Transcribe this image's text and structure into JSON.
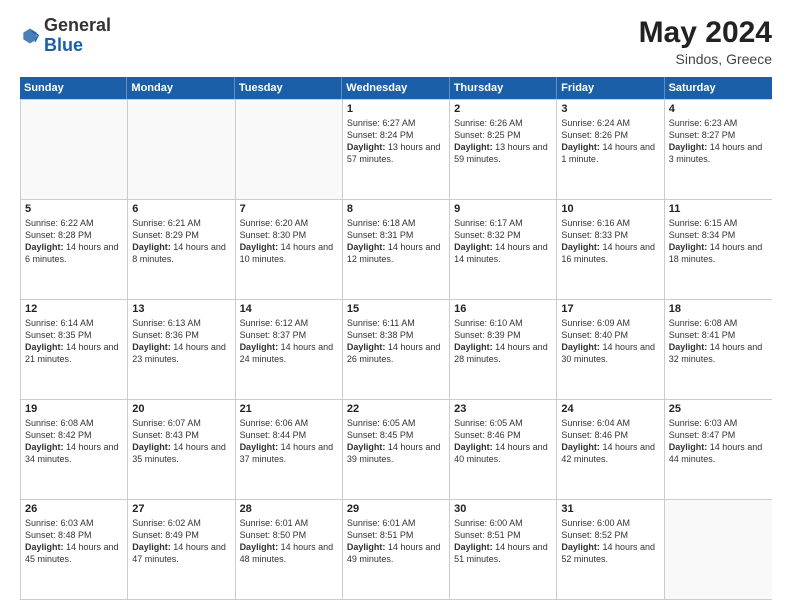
{
  "header": {
    "logo_general": "General",
    "logo_blue": "Blue",
    "month_year": "May 2024",
    "location": "Sindos, Greece"
  },
  "days_of_week": [
    "Sunday",
    "Monday",
    "Tuesday",
    "Wednesday",
    "Thursday",
    "Friday",
    "Saturday"
  ],
  "weeks": [
    [
      {
        "day": "",
        "sunrise": "",
        "sunset": "",
        "daylight": "",
        "empty": true
      },
      {
        "day": "",
        "sunrise": "",
        "sunset": "",
        "daylight": "",
        "empty": true
      },
      {
        "day": "",
        "sunrise": "",
        "sunset": "",
        "daylight": "",
        "empty": true
      },
      {
        "day": "1",
        "sunrise": "Sunrise: 6:27 AM",
        "sunset": "Sunset: 8:24 PM",
        "daylight": "Daylight: 13 hours and 57 minutes.",
        "empty": false
      },
      {
        "day": "2",
        "sunrise": "Sunrise: 6:26 AM",
        "sunset": "Sunset: 8:25 PM",
        "daylight": "Daylight: 13 hours and 59 minutes.",
        "empty": false
      },
      {
        "day": "3",
        "sunrise": "Sunrise: 6:24 AM",
        "sunset": "Sunset: 8:26 PM",
        "daylight": "Daylight: 14 hours and 1 minute.",
        "empty": false
      },
      {
        "day": "4",
        "sunrise": "Sunrise: 6:23 AM",
        "sunset": "Sunset: 8:27 PM",
        "daylight": "Daylight: 14 hours and 3 minutes.",
        "empty": false
      }
    ],
    [
      {
        "day": "5",
        "sunrise": "Sunrise: 6:22 AM",
        "sunset": "Sunset: 8:28 PM",
        "daylight": "Daylight: 14 hours and 6 minutes.",
        "empty": false
      },
      {
        "day": "6",
        "sunrise": "Sunrise: 6:21 AM",
        "sunset": "Sunset: 8:29 PM",
        "daylight": "Daylight: 14 hours and 8 minutes.",
        "empty": false
      },
      {
        "day": "7",
        "sunrise": "Sunrise: 6:20 AM",
        "sunset": "Sunset: 8:30 PM",
        "daylight": "Daylight: 14 hours and 10 minutes.",
        "empty": false
      },
      {
        "day": "8",
        "sunrise": "Sunrise: 6:18 AM",
        "sunset": "Sunset: 8:31 PM",
        "daylight": "Daylight: 14 hours and 12 minutes.",
        "empty": false
      },
      {
        "day": "9",
        "sunrise": "Sunrise: 6:17 AM",
        "sunset": "Sunset: 8:32 PM",
        "daylight": "Daylight: 14 hours and 14 minutes.",
        "empty": false
      },
      {
        "day": "10",
        "sunrise": "Sunrise: 6:16 AM",
        "sunset": "Sunset: 8:33 PM",
        "daylight": "Daylight: 14 hours and 16 minutes.",
        "empty": false
      },
      {
        "day": "11",
        "sunrise": "Sunrise: 6:15 AM",
        "sunset": "Sunset: 8:34 PM",
        "daylight": "Daylight: 14 hours and 18 minutes.",
        "empty": false
      }
    ],
    [
      {
        "day": "12",
        "sunrise": "Sunrise: 6:14 AM",
        "sunset": "Sunset: 8:35 PM",
        "daylight": "Daylight: 14 hours and 21 minutes.",
        "empty": false
      },
      {
        "day": "13",
        "sunrise": "Sunrise: 6:13 AM",
        "sunset": "Sunset: 8:36 PM",
        "daylight": "Daylight: 14 hours and 23 minutes.",
        "empty": false
      },
      {
        "day": "14",
        "sunrise": "Sunrise: 6:12 AM",
        "sunset": "Sunset: 8:37 PM",
        "daylight": "Daylight: 14 hours and 24 minutes.",
        "empty": false
      },
      {
        "day": "15",
        "sunrise": "Sunrise: 6:11 AM",
        "sunset": "Sunset: 8:38 PM",
        "daylight": "Daylight: 14 hours and 26 minutes.",
        "empty": false
      },
      {
        "day": "16",
        "sunrise": "Sunrise: 6:10 AM",
        "sunset": "Sunset: 8:39 PM",
        "daylight": "Daylight: 14 hours and 28 minutes.",
        "empty": false
      },
      {
        "day": "17",
        "sunrise": "Sunrise: 6:09 AM",
        "sunset": "Sunset: 8:40 PM",
        "daylight": "Daylight: 14 hours and 30 minutes.",
        "empty": false
      },
      {
        "day": "18",
        "sunrise": "Sunrise: 6:08 AM",
        "sunset": "Sunset: 8:41 PM",
        "daylight": "Daylight: 14 hours and 32 minutes.",
        "empty": false
      }
    ],
    [
      {
        "day": "19",
        "sunrise": "Sunrise: 6:08 AM",
        "sunset": "Sunset: 8:42 PM",
        "daylight": "Daylight: 14 hours and 34 minutes.",
        "empty": false
      },
      {
        "day": "20",
        "sunrise": "Sunrise: 6:07 AM",
        "sunset": "Sunset: 8:43 PM",
        "daylight": "Daylight: 14 hours and 35 minutes.",
        "empty": false
      },
      {
        "day": "21",
        "sunrise": "Sunrise: 6:06 AM",
        "sunset": "Sunset: 8:44 PM",
        "daylight": "Daylight: 14 hours and 37 minutes.",
        "empty": false
      },
      {
        "day": "22",
        "sunrise": "Sunrise: 6:05 AM",
        "sunset": "Sunset: 8:45 PM",
        "daylight": "Daylight: 14 hours and 39 minutes.",
        "empty": false
      },
      {
        "day": "23",
        "sunrise": "Sunrise: 6:05 AM",
        "sunset": "Sunset: 8:46 PM",
        "daylight": "Daylight: 14 hours and 40 minutes.",
        "empty": false
      },
      {
        "day": "24",
        "sunrise": "Sunrise: 6:04 AM",
        "sunset": "Sunset: 8:46 PM",
        "daylight": "Daylight: 14 hours and 42 minutes.",
        "empty": false
      },
      {
        "day": "25",
        "sunrise": "Sunrise: 6:03 AM",
        "sunset": "Sunset: 8:47 PM",
        "daylight": "Daylight: 14 hours and 44 minutes.",
        "empty": false
      }
    ],
    [
      {
        "day": "26",
        "sunrise": "Sunrise: 6:03 AM",
        "sunset": "Sunset: 8:48 PM",
        "daylight": "Daylight: 14 hours and 45 minutes.",
        "empty": false
      },
      {
        "day": "27",
        "sunrise": "Sunrise: 6:02 AM",
        "sunset": "Sunset: 8:49 PM",
        "daylight": "Daylight: 14 hours and 47 minutes.",
        "empty": false
      },
      {
        "day": "28",
        "sunrise": "Sunrise: 6:01 AM",
        "sunset": "Sunset: 8:50 PM",
        "daylight": "Daylight: 14 hours and 48 minutes.",
        "empty": false
      },
      {
        "day": "29",
        "sunrise": "Sunrise: 6:01 AM",
        "sunset": "Sunset: 8:51 PM",
        "daylight": "Daylight: 14 hours and 49 minutes.",
        "empty": false
      },
      {
        "day": "30",
        "sunrise": "Sunrise: 6:00 AM",
        "sunset": "Sunset: 8:51 PM",
        "daylight": "Daylight: 14 hours and 51 minutes.",
        "empty": false
      },
      {
        "day": "31",
        "sunrise": "Sunrise: 6:00 AM",
        "sunset": "Sunset: 8:52 PM",
        "daylight": "Daylight: 14 hours and 52 minutes.",
        "empty": false
      },
      {
        "day": "",
        "sunrise": "",
        "sunset": "",
        "daylight": "",
        "empty": true
      }
    ]
  ]
}
